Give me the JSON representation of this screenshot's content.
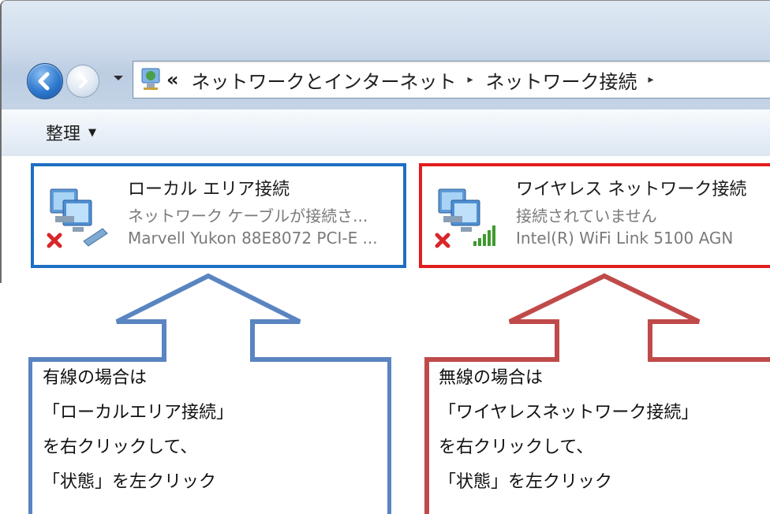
{
  "window": {
    "address_bar": {
      "breadcrumb_overflow": "«",
      "crumbs": [
        "ネットワークとインターネット",
        "ネットワーク接続"
      ],
      "separator": "▸"
    },
    "toolbar": {
      "organize_label": "整理",
      "organize_caret": "▼"
    },
    "connections": [
      {
        "name": "ローカル エリア接続",
        "status": "ネットワーク ケーブルが接続さ...",
        "device": "Marvell Yukon 88E8072 PCI-E ...",
        "icon": "wired-network-disconnected-icon",
        "highlight_color": "#1c6fc2"
      },
      {
        "name": "ワイヤレス ネットワーク接続",
        "status": "接続されていません",
        "device": "Intel(R) WiFi Link 5100 AGN",
        "icon": "wireless-network-disconnected-icon",
        "highlight_color": "#e01e1e"
      }
    ]
  },
  "callouts": [
    {
      "color": "#5a84c2",
      "lines": [
        "有線の場合は",
        "「ローカルエリア接続」",
        "を右クリックして、",
        "「状態」を左クリック"
      ]
    },
    {
      "color": "#c04a4a",
      "lines": [
        "無線の場合は",
        "「ワイヤレスネットワーク接続」",
        "を右クリックして、",
        "「状態」を左クリック"
      ]
    }
  ]
}
